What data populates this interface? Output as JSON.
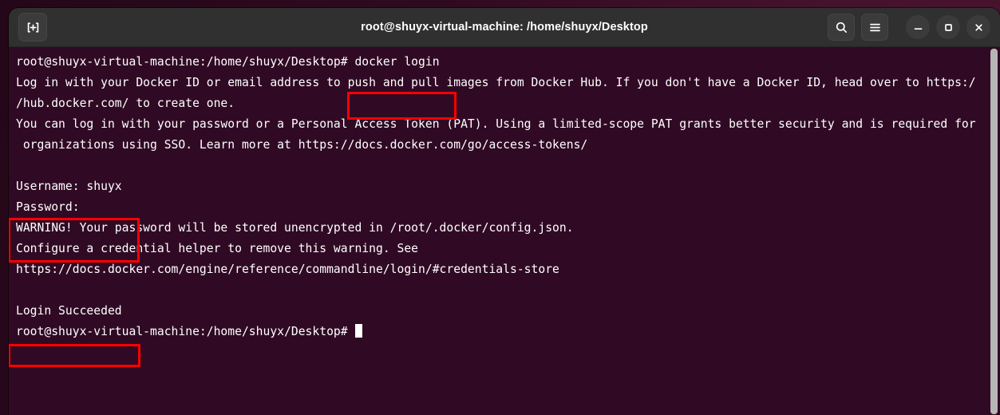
{
  "window": {
    "title": "root@shuyx-virtual-machine: /home/shuyx/Desktop",
    "titlebar": {
      "new_tab_label": "new-tab",
      "search_label": "Search",
      "menu_label": "Menu",
      "minimize_label": "Minimize",
      "maximize_label": "Maximize",
      "close_label": "Close"
    },
    "colors": {
      "terminal_background": "#300a24",
      "titlebar_background": "#303030",
      "text": "#ffffff",
      "annotation_red": "#fe0000",
      "scrollbar_thumb": "#b6b6b6"
    }
  },
  "terminal": {
    "lines": [
      {
        "id": "prompt-1",
        "text": "root@shuyx-virtual-machine:/home/shuyx/Desktop# docker login"
      },
      {
        "id": "out-1",
        "text": "Log in with your Docker ID or email address to push and pull images from Docker Hub. If you don't have a Docker ID, head over to https:/"
      },
      {
        "id": "out-2",
        "text": "/hub.docker.com/ to create one."
      },
      {
        "id": "out-3",
        "text": "You can log in with your password or a Personal Access Token (PAT). Using a limited-scope PAT grants better security and is required for"
      },
      {
        "id": "out-4",
        "text": " organizations using SSO. Learn more at https://docs.docker.com/go/access-tokens/"
      },
      {
        "id": "blank-1",
        "text": ""
      },
      {
        "id": "username",
        "text": "Username: shuyx"
      },
      {
        "id": "password",
        "text": "Password:"
      },
      {
        "id": "warning-1",
        "text": "WARNING! Your password will be stored unencrypted in /root/.docker/config.json."
      },
      {
        "id": "warning-2",
        "text": "Configure a credential helper to remove this warning. See"
      },
      {
        "id": "warning-3",
        "text": "https://docs.docker.com/engine/reference/commandline/login/#credentials-store"
      },
      {
        "id": "blank-2",
        "text": ""
      },
      {
        "id": "succeeded",
        "text": "Login Succeeded"
      },
      {
        "id": "prompt-2",
        "text": "root@shuyx-virtual-machine:/home/shuyx/Desktop# "
      }
    ]
  },
  "annotations": [
    {
      "id": "hl-docker-login",
      "label": "docker login",
      "target": "docker login command"
    },
    {
      "id": "hl-credentials",
      "label": "Username: shuyx / Password:",
      "target": "credential prompts"
    },
    {
      "id": "hl-succeeded",
      "label": "Login Succeeded",
      "target": "login success message"
    }
  ]
}
